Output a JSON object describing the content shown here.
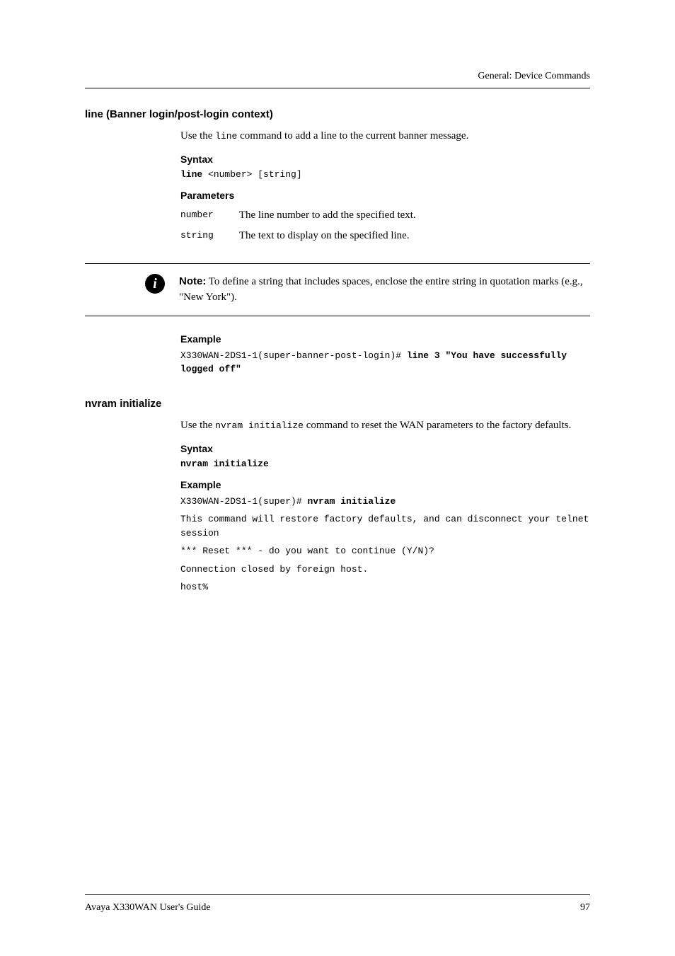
{
  "header": {
    "breadcrumb": "General: Device Commands"
  },
  "sections": {
    "line": {
      "title": "line (Banner login/post-login context)",
      "intro_pre": "Use the ",
      "intro_cmd": "line",
      "intro_post": " command to add a line to the current banner message.",
      "syntax_label": "Syntax",
      "syntax_code_bold": "line",
      "syntax_code_rest": " <number> [string]",
      "params_label": "Parameters",
      "params": [
        {
          "name": "number",
          "desc": "The line number to add the specified text."
        },
        {
          "name": "string",
          "desc": "The text to display on the specified line."
        }
      ],
      "note_label": "Note:",
      "note_text": "  To define a string that includes spaces, enclose the entire string in quotation marks (e.g., \"New York\").",
      "example_label": "Example",
      "example_prompt": "X330WAN-2DS1-1(super-banner-post-login)# ",
      "example_cmd": "line 3 \"You have successfully logged off\""
    },
    "nvram": {
      "title": "nvram initialize",
      "intro_pre": "Use the ",
      "intro_cmd": "nvram initialize",
      "intro_post": " command to reset the WAN parameters to the factory defaults.",
      "syntax_label": "Syntax",
      "syntax_code": "nvram initialize",
      "example_label": "Example",
      "example_prompt": "X330WAN-2DS1-1(super)# ",
      "example_cmd": "nvram initialize",
      "example_output": [
        "This command will restore factory defaults, and can disconnect your telnet session",
        "*** Reset *** - do you want to continue (Y/N)?",
        "Connection closed by foreign host.",
        "host%"
      ]
    }
  },
  "footer": {
    "left": "Avaya X330WAN User's Guide",
    "right": "97"
  }
}
